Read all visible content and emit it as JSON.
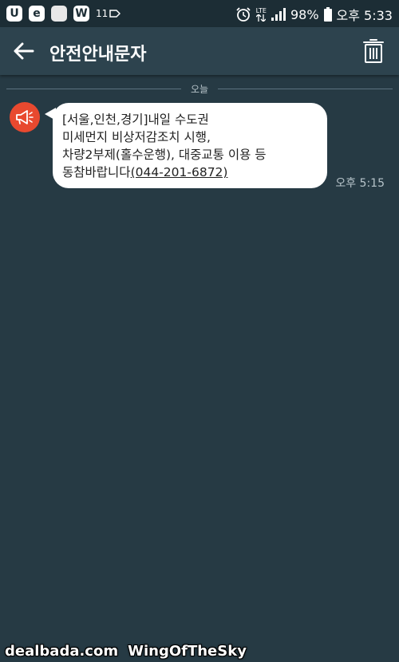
{
  "status_bar": {
    "app_icons": [
      {
        "name": "u-app-icon",
        "glyph": "U"
      },
      {
        "name": "e-app-icon",
        "glyph": "e"
      },
      {
        "name": "blank-app-icon",
        "glyph": ""
      },
      {
        "name": "w-app-icon",
        "glyph": "W"
      }
    ],
    "extra_text": "11",
    "lte_label": "LTE",
    "battery_percent": "98%",
    "clock": "오후 5:33"
  },
  "app_bar": {
    "title": "안전안내문자"
  },
  "conversation": {
    "date_label": "오늘",
    "message": {
      "lines": [
        "[서울,인천,경기]내일 수도권",
        "미세먼지 비상저감조치 시행,",
        "차량2부제(홀수운행), 대중교통 이용 등"
      ],
      "last_line_prefix": "동참바랍니다",
      "phone_number": "(044-201-6872)",
      "time": "오후 5:15"
    }
  },
  "watermark": {
    "site": "dealbada.com",
    "author": "WingOfTheSky"
  },
  "colors": {
    "background": "#263a44",
    "app_bar": "#2d434e",
    "status_bar": "#1c2d35",
    "avatar": "#e8492f",
    "bubble": "#ffffff"
  }
}
